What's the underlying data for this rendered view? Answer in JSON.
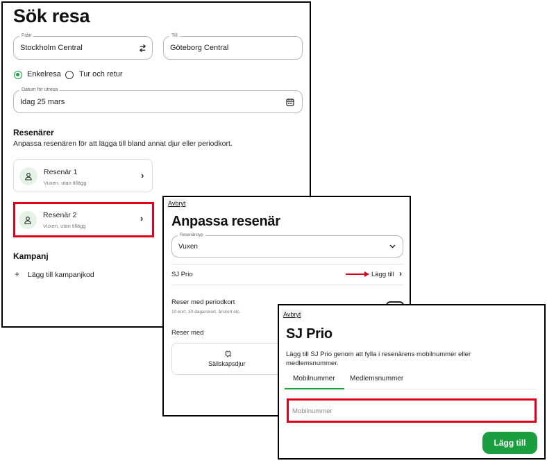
{
  "search": {
    "title": "Sök resa",
    "from": {
      "label": "Från",
      "value": "Stockholm Central"
    },
    "to": {
      "label": "Till",
      "value": "Göteborg Central"
    },
    "trip_type": {
      "one_way": "Enkelresa",
      "return": "Tur och retur",
      "selected": "one_way"
    },
    "date": {
      "label": "Datum för utresa",
      "value": "Idag 25 mars"
    },
    "travelers": {
      "heading": "Resenärer",
      "description": "Anpassa resenären för att lägga till bland annat djur eller periodkort.",
      "items": [
        {
          "name": "Resenär 1",
          "detail": "Vuxen, utan tillägg"
        },
        {
          "name": "Resenär 2",
          "detail": "Vuxen, utan tillägg"
        }
      ]
    },
    "campaign": {
      "heading": "Kampanj",
      "add_label": "Lägg till kampanjkod"
    }
  },
  "customize": {
    "cancel": "Avbryt",
    "title": "Anpassa resenär",
    "traveler_type": {
      "label": "Resenärstyp",
      "value": "Vuxen"
    },
    "sj_prio": {
      "label": "SJ Prio",
      "action": "Lägg till"
    },
    "commuter": {
      "label": "Reser med periodkort",
      "detail": "10-kort, 30-dagarskort, årskort etc."
    },
    "travels_with": {
      "label": "Reser med",
      "pet": "Sällskapsdjur"
    }
  },
  "sjprio": {
    "cancel": "Avbryt",
    "title": "SJ Prio",
    "description": "Lägg till SJ Prio genom att fylla i resenärens mobilnummer eller medlemsnummer.",
    "tabs": [
      {
        "label": "Mobilnummer",
        "active": true
      },
      {
        "label": "Medlemsnummer",
        "active": false
      }
    ],
    "input_placeholder": "Mobilnummer",
    "submit": "Lägg till"
  },
  "colors": {
    "accent": "#1a9e3f",
    "highlight": "#e0001a",
    "avatar_bg": "#e5f2e6"
  }
}
